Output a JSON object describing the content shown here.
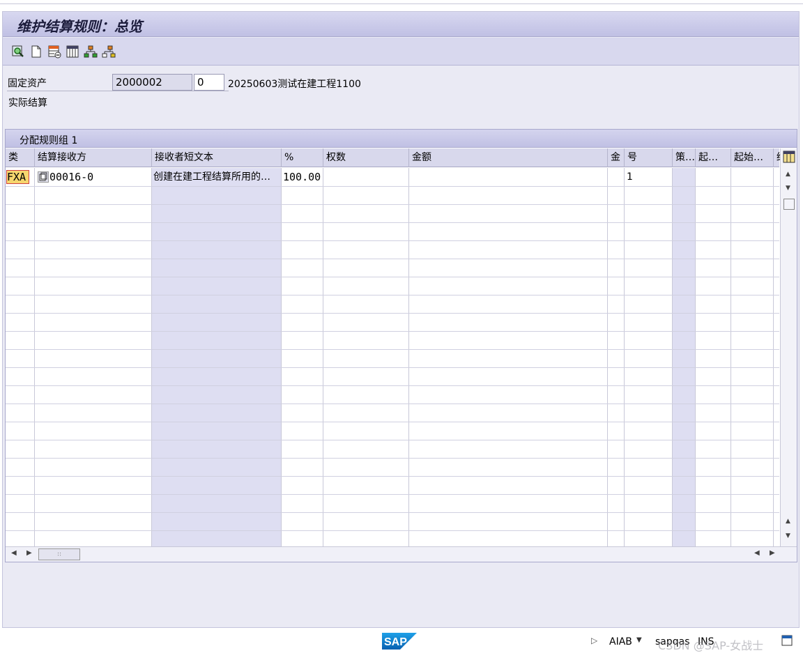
{
  "window": {
    "title": "维护结算规则：总览"
  },
  "toolbar": {
    "icons": [
      "display-object-icon",
      "new-entry-icon",
      "delete-row-icon",
      "columns-icon",
      "hierarchy-icon",
      "hierarchy-alt-icon"
    ]
  },
  "header": {
    "asset_label": "固定资产",
    "asset_number": "2000002",
    "sub_number": "0",
    "asset_description": "20250603测试在建工程1100",
    "settlement_type": "实际结算"
  },
  "panel": {
    "title": "分配规则组 1"
  },
  "table": {
    "columns": [
      "类",
      "结算接收方",
      "接收者短文本",
      "%",
      "权数",
      "金额",
      "金",
      "号",
      "策…",
      "起…",
      "起始…",
      "结"
    ],
    "rows": [
      {
        "cat": "FXA",
        "receiver": "00016-0",
        "short_text": "创建在建工程结算所用的…",
        "percent": "100.00",
        "weight": "",
        "amount": "",
        "currency": "",
        "number": "1",
        "strategy": "",
        "from1": "",
        "from2": ""
      }
    ]
  },
  "statusbar": {
    "logo": "SAP",
    "transaction": "AIAB",
    "system": "sapqas",
    "mode": "INS",
    "watermark": "CSDN @SAP-女战士"
  },
  "colors": {
    "accent": "#c0c0e4",
    "selection": "#f6d66e"
  }
}
